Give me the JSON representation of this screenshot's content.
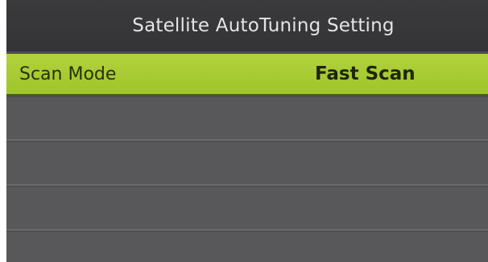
{
  "window": {
    "title": "Satellite AutoTuning Setting"
  },
  "menu": {
    "items": [
      {
        "label": "Scan Mode",
        "value": "Fast Scan",
        "selected": true
      }
    ]
  },
  "colors": {
    "highlight": "#a8cb32",
    "background": "#4e4e50",
    "title_bar": "#363639"
  }
}
